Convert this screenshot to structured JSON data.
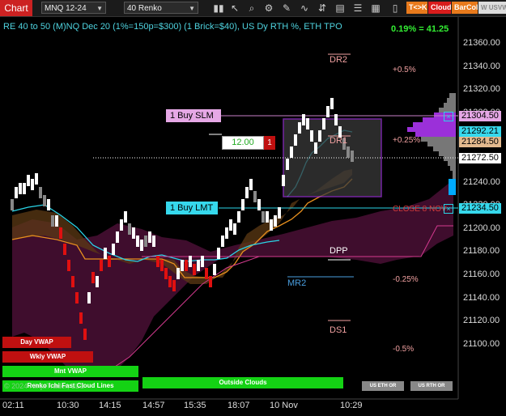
{
  "toolbar": {
    "title": "Chart",
    "instrument": "MNQ 12-24",
    "bar_type": "40 Renko",
    "btn_tk": "T<>K",
    "btn_cloud": "Cloud",
    "btn_barcol": "BarCol",
    "btn_w": "W USVWAP"
  },
  "header": {
    "info": "RE 40 to 50 (M)NQ Dec 20 (1%=150p=$300) (1 Brick=$40), US Dy RTH %, ETH TPO",
    "pct": "0.19% = 41.25"
  },
  "y_axis": [
    "21360.00",
    "21340.00",
    "21320.00",
    "21300.00",
    "21280.00",
    "21260.00",
    "21240.00",
    "21220.00",
    "21200.00",
    "21180.00",
    "21160.00",
    "21140.00",
    "21120.00",
    "21100.00"
  ],
  "x_axis": [
    "02:11",
    "10:30",
    "14:15",
    "14:57",
    "15:35",
    "18:07",
    "10 Nov",
    "10:29"
  ],
  "levels": {
    "dr2": "DR2",
    "dr1": "DR1",
    "dpp": "DPP",
    "mr2": "MR2",
    "ds1": "DS1",
    "p05": "+0.5%",
    "p025": "+0.25%",
    "m025": "-0.25%",
    "m05": "-0.5%",
    "close": "CLOSE 8 NOV"
  },
  "orders": {
    "buy_slm": "1 Buy SLM",
    "buy_lmt": "1 Buy LMT",
    "qty": "12.00",
    "qty_count": "1"
  },
  "price_tags": {
    "slm": "21304.50",
    "cur": "21292.21",
    "tan": "21284.50",
    "dotted": "21272.50",
    "lmt": "21234.50"
  },
  "buttons": {
    "day_vwap": "Day VWAP",
    "wkly_vwap": "Wkly VWAP",
    "mnt_vwap": "Mnt VWAP",
    "renko_cloud": "Renko Ichi Fast Cloud Lines",
    "outside_clouds": "Outside Clouds",
    "us_eth": "US ETH OR",
    "us_rth": "US RTH OR"
  },
  "copyright": "© 2024 NinjaTrader, LLC",
  "colors": {
    "up_brick": "#ffffff",
    "down_brick": "#e01010",
    "cyan": "#2ad4e6",
    "orange": "#e8901e",
    "cloud": "#5a1440",
    "purple_box": "#9b30d9"
  }
}
